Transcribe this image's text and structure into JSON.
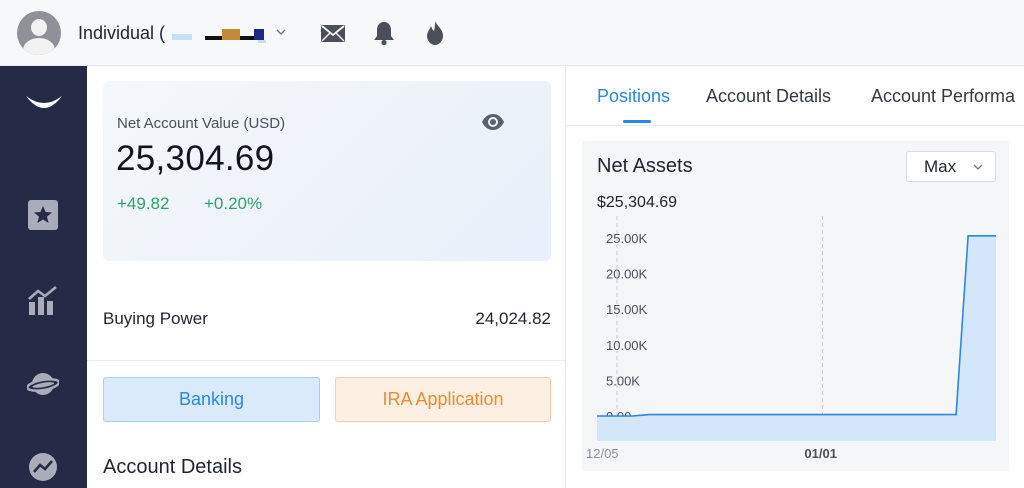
{
  "header": {
    "account_name": "Individual (",
    "icons": [
      "avatar",
      "chevron-down-icon",
      "mail-icon",
      "bell-icon",
      "flame-icon"
    ]
  },
  "sidebar": {
    "icons": [
      "logo-smile-icon",
      "star-watchlist-icon",
      "chart-bars-icon",
      "planet-icon",
      "chat-trend-icon"
    ]
  },
  "account_summary": {
    "label": "Net Account Value (USD)",
    "value": "25,304.69",
    "change_amount": "+49.82",
    "change_percent": "+0.20%",
    "buying_power_label": "Buying Power",
    "buying_power_value": "24,024.82",
    "banking_button": "Banking",
    "ira_button": "IRA Application",
    "section_heading": "Account Details"
  },
  "tabs": [
    {
      "label": "Positions",
      "active": true
    },
    {
      "label": "Account Details",
      "active": false
    },
    {
      "label": "Account Performa",
      "active": false
    }
  ],
  "chart_panel": {
    "title": "Net Assets",
    "range": "Max",
    "current_value": "$25,304.69"
  },
  "colors": {
    "sidebar": "#252a47",
    "accent_blue": "#2c86e2",
    "positive_green": "#2aa36f",
    "ira_orange": "#ef8a37"
  },
  "chart_data": {
    "type": "area",
    "x_tick_labels": [
      "12/05",
      "01/01"
    ],
    "y_tick_labels": [
      "25.00K",
      "20.00K",
      "15.00K",
      "10.00K",
      "5.00K",
      "0.00"
    ],
    "ylim": [
      0,
      25000
    ],
    "grid": "vertical dashed at x ticks",
    "series": [
      {
        "points": [
          {
            "t": 0.0,
            "y": 0
          },
          {
            "t": 0.09,
            "y": 0
          },
          {
            "t": 0.13,
            "y": 200
          },
          {
            "t": 0.9,
            "y": 200
          },
          {
            "t": 0.93,
            "y": 25304.69
          },
          {
            "t": 1.0,
            "y": 25304.69
          }
        ]
      }
    ]
  }
}
